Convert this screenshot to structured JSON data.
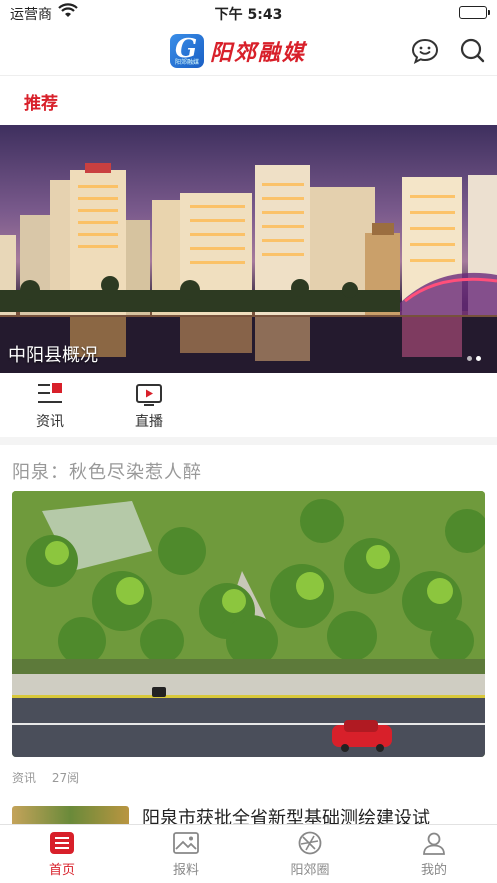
{
  "status_bar": {
    "carrier": "运营商",
    "time": "下午 5:43"
  },
  "header": {
    "app_name": "阳郊融媒",
    "badge_small_text": "阳郊融媒"
  },
  "category_tab": "推荐",
  "banner": {
    "caption": "中阳县概况",
    "dots": 2,
    "active_dot": 1
  },
  "quick_nav": [
    {
      "label": "资讯",
      "icon": "news-icon"
    },
    {
      "label": "直播",
      "icon": "live-icon"
    }
  ],
  "articles": [
    {
      "title": "阳泉：秋色尽染惹人醉",
      "category": "资讯",
      "views": "27阅"
    },
    {
      "title": "阳泉市获批全省新型基础测绘建设试"
    }
  ],
  "tab_bar": [
    {
      "label": "首页",
      "icon": "home-icon",
      "active": true
    },
    {
      "label": "报料",
      "icon": "image-icon",
      "active": false
    },
    {
      "label": "阳郊圈",
      "icon": "circle-icon",
      "active": false
    },
    {
      "label": "我的",
      "icon": "user-icon",
      "active": false
    }
  ],
  "colors": {
    "accent": "#d8202a",
    "muted": "#999999",
    "logo_blue": "#1a5fc4"
  }
}
